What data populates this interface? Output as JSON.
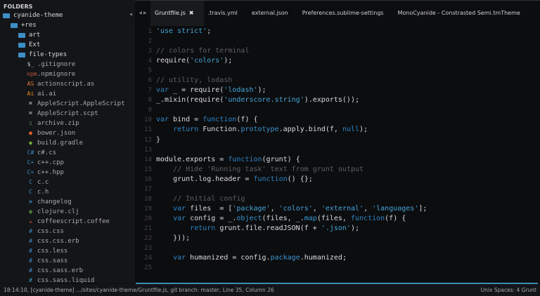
{
  "sidebar": {
    "title": "FOLDERS",
    "items": [
      {
        "label": "cyanide-theme",
        "type": "folder-open",
        "depth": 0
      },
      {
        "label": "+res",
        "type": "folder-open",
        "depth": 1
      },
      {
        "label": "art",
        "type": "folder",
        "depth": 2
      },
      {
        "label": "Ext",
        "type": "folder",
        "depth": 2
      },
      {
        "label": "file-types",
        "type": "folder-open",
        "depth": 2
      },
      {
        "label": ".gitignore",
        "type": "file",
        "depth": 3,
        "icon": "$_",
        "color": "#cccccc",
        "icon_name": "terminal-icon"
      },
      {
        "label": ".npmignore",
        "type": "file",
        "depth": 3,
        "icon": "npm",
        "color": "#c0573a",
        "icon_name": "npm-icon"
      },
      {
        "label": "actionscript.as",
        "type": "file",
        "depth": 3,
        "icon": "AS",
        "color": "#e07a3a",
        "icon_name": "actionscript-icon"
      },
      {
        "label": "ai.ai",
        "type": "file",
        "depth": 3,
        "icon": "Ai",
        "color": "#f08a1e",
        "icon_name": "illustrator-icon"
      },
      {
        "label": "AppleScript.AppleScript",
        "type": "file",
        "depth": 3,
        "icon": "⌘",
        "color": "#cccccc",
        "icon_name": "applescript-icon"
      },
      {
        "label": "AppleScript.scpt",
        "type": "file",
        "depth": 3,
        "icon": "⌘",
        "color": "#cccccc",
        "icon_name": "applescript-icon"
      },
      {
        "label": "archive.zip",
        "type": "file",
        "depth": 3,
        "icon": "▯",
        "color": "#5fa05f",
        "icon_name": "archive-icon"
      },
      {
        "label": "bower.json",
        "type": "file",
        "depth": 3,
        "icon": "●",
        "color": "#e0602a",
        "icon_name": "bower-icon"
      },
      {
        "label": "build.gradle",
        "type": "file",
        "depth": 3,
        "icon": "◉",
        "color": "#7ec13a",
        "icon_name": "gradle-icon"
      },
      {
        "label": "c#.cs",
        "type": "file",
        "depth": 3,
        "icon": "C#",
        "color": "#3d8fc6",
        "icon_name": "csharp-icon"
      },
      {
        "label": "c++.cpp",
        "type": "file",
        "depth": 3,
        "icon": "C+",
        "color": "#3d8fc6",
        "icon_name": "cpp-icon"
      },
      {
        "label": "c++.hpp",
        "type": "file",
        "depth": 3,
        "icon": "C+",
        "color": "#3d8fc6",
        "icon_name": "cpp-icon"
      },
      {
        "label": "c.c",
        "type": "file",
        "depth": 3,
        "icon": "C",
        "color": "#3d8fc6",
        "icon_name": "c-icon"
      },
      {
        "label": "c.h",
        "type": "file",
        "depth": 3,
        "icon": "C",
        "color": "#3d8fc6",
        "icon_name": "c-icon"
      },
      {
        "label": "changelog",
        "type": "file",
        "depth": 3,
        "icon": "≡",
        "color": "#3d8fc6",
        "icon_name": "changelog-icon"
      },
      {
        "label": "clojure.clj",
        "type": "file",
        "depth": 3,
        "icon": "◍",
        "color": "#6ab04c",
        "icon_name": "clojure-icon"
      },
      {
        "label": "coffeescript.coffee",
        "type": "file",
        "depth": 3,
        "icon": "☕",
        "color": "#e0602a",
        "icon_name": "coffee-icon"
      },
      {
        "label": "css.css",
        "type": "file",
        "depth": 3,
        "icon": "#",
        "color": "#3d8fc6",
        "icon_name": "css-icon"
      },
      {
        "label": "css.css.erb",
        "type": "file",
        "depth": 3,
        "icon": "#",
        "color": "#3d8fc6",
        "icon_name": "css-icon"
      },
      {
        "label": "css.less",
        "type": "file",
        "depth": 3,
        "icon": "#",
        "color": "#3d8fc6",
        "icon_name": "css-icon"
      },
      {
        "label": "css.sass",
        "type": "file",
        "depth": 3,
        "icon": "#",
        "color": "#3d8fc6",
        "icon_name": "css-icon"
      },
      {
        "label": "css.sass.erb",
        "type": "file",
        "depth": 3,
        "icon": "#",
        "color": "#3d8fc6",
        "icon_name": "css-icon"
      },
      {
        "label": "css.sass.liquid",
        "type": "file",
        "depth": 3,
        "icon": "#",
        "color": "#3d8fc6",
        "icon_name": "css-icon"
      }
    ]
  },
  "tabs": [
    {
      "label": "Gruntfile.js",
      "active": true,
      "close": "✖"
    },
    {
      "label": ".travis.yml"
    },
    {
      "label": "external.json"
    },
    {
      "label": "Preferences.sublime-settings"
    },
    {
      "label": "MonoCyanide - Constrasted Semi.tmTheme"
    }
  ],
  "editor": {
    "lines": [
      [
        [
          "str",
          "'use strict'"
        ],
        [
          "pl",
          ";"
        ]
      ],
      [],
      [
        [
          "cm",
          "// colors for terminal"
        ]
      ],
      [
        [
          "pl",
          "require("
        ],
        [
          "str",
          "'colors'"
        ],
        [
          "pl",
          ");"
        ]
      ],
      [],
      [
        [
          "cm",
          "// utility, lodash"
        ]
      ],
      [
        [
          "kw",
          "var"
        ],
        [
          "pl",
          " _ = require("
        ],
        [
          "str",
          "'lodash'"
        ],
        [
          "pl",
          ");"
        ]
      ],
      [
        [
          "pl",
          "_.mixin(require("
        ],
        [
          "str",
          "'underscore.string'"
        ],
        [
          "pl",
          ").exports());"
        ]
      ],
      [],
      [
        [
          "kw",
          "var"
        ],
        [
          "pl",
          " bind = "
        ],
        [
          "fn",
          "function"
        ],
        [
          "pl",
          "(f) {"
        ]
      ],
      [
        [
          "pl",
          "    "
        ],
        [
          "kw",
          "return"
        ],
        [
          "pl",
          " Function."
        ],
        [
          "prop",
          "prototype"
        ],
        [
          "pl",
          ".apply.bind(f, "
        ],
        [
          "kw",
          "null"
        ],
        [
          "pl",
          ");"
        ]
      ],
      [
        [
          "pl",
          "}"
        ]
      ],
      [],
      [
        [
          "pl",
          "module.exports = "
        ],
        [
          "fn",
          "function"
        ],
        [
          "pl",
          "(grunt) {"
        ]
      ],
      [
        [
          "cm",
          "    // Hide 'Running task' text from grunt output"
        ]
      ],
      [
        [
          "pl",
          "    grunt.log.header = "
        ],
        [
          "fn",
          "function"
        ],
        [
          "pl",
          "() {};"
        ]
      ],
      [],
      [
        [
          "cm",
          "    // Initial config"
        ]
      ],
      [
        [
          "pl",
          "    "
        ],
        [
          "kw",
          "var"
        ],
        [
          "pl",
          " files  = ["
        ],
        [
          "str",
          "'package'"
        ],
        [
          "pl",
          ", "
        ],
        [
          "str",
          "'colors'"
        ],
        [
          "pl",
          ", "
        ],
        [
          "str",
          "'external'"
        ],
        [
          "pl",
          ", "
        ],
        [
          "str",
          "'languages'"
        ],
        [
          "pl",
          "];"
        ]
      ],
      [
        [
          "pl",
          "    "
        ],
        [
          "kw",
          "var"
        ],
        [
          "pl",
          " config = _."
        ],
        [
          "prop",
          "object"
        ],
        [
          "pl",
          "(files, _."
        ],
        [
          "prop",
          "map"
        ],
        [
          "pl",
          "(files, "
        ],
        [
          "fn",
          "function"
        ],
        [
          "pl",
          "(f) {"
        ]
      ],
      [
        [
          "pl",
          "        "
        ],
        [
          "kw",
          "return"
        ],
        [
          "pl",
          " grunt.file.readJSON(f + "
        ],
        [
          "str",
          "'.json'"
        ],
        [
          "pl",
          ");"
        ]
      ],
      [
        [
          "pl",
          "    }));"
        ]
      ],
      [],
      [
        [
          "pl",
          "    "
        ],
        [
          "kw",
          "var"
        ],
        [
          "pl",
          " humanized = config."
        ],
        [
          "prop",
          "package"
        ],
        [
          "pl",
          ".humanized;"
        ]
      ],
      []
    ]
  },
  "status": {
    "left": "18:14:10, [cyanide-theme] .../sites/cyanide-theme/Gruntfile.js, git branch: master, Line 35, Column 26",
    "right": "Unix Spaces: 4 Grunt"
  }
}
